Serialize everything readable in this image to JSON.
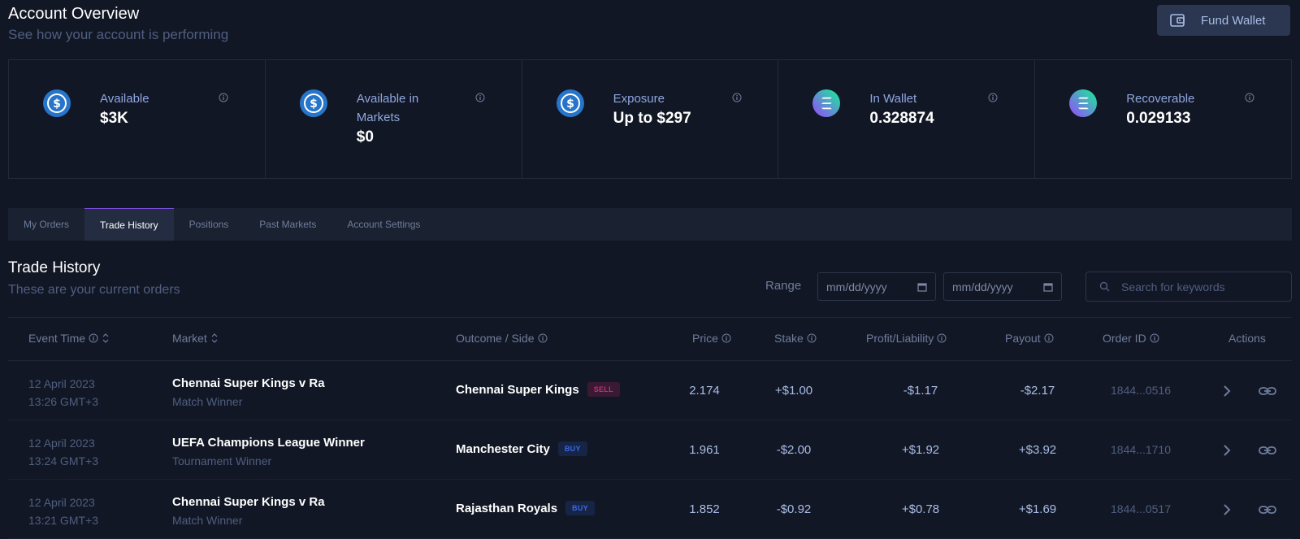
{
  "header": {
    "title": "Account Overview",
    "subtitle": "See how your account is performing",
    "fund_button": "Fund Wallet"
  },
  "cards": [
    {
      "label": "Available",
      "value": "$3K",
      "icon": "usdc-coin-icon"
    },
    {
      "label": "Available in Markets",
      "value": "$0",
      "icon": "usdc-coin-icon"
    },
    {
      "label": "Exposure",
      "value": "Up to $297",
      "icon": "usdc-coin-icon"
    },
    {
      "label": "In Wallet",
      "value": "0.328874",
      "icon": "solana-coin-icon"
    },
    {
      "label": "Recoverable",
      "value": "0.029133",
      "icon": "solana-coin-icon"
    }
  ],
  "tabs": [
    {
      "label": "My Orders"
    },
    {
      "label": "Trade History",
      "active": true
    },
    {
      "label": "Positions"
    },
    {
      "label": "Past Markets"
    },
    {
      "label": "Account Settings"
    }
  ],
  "section": {
    "title": "Trade History",
    "subtitle": "These are your current orders",
    "range_label": "Range",
    "date_from_placeholder": "mm/dd/yyyy",
    "date_to_placeholder": "mm/dd/yyyy",
    "search_placeholder": "Search for keywords"
  },
  "table": {
    "columns": [
      "Event Time",
      "Market",
      "Outcome / Side",
      "Price",
      "Stake",
      "Profit/Liability",
      "Payout",
      "Order ID",
      "Actions"
    ],
    "rows": [
      {
        "date": "12 April 2023",
        "time": "13:26 GMT+3",
        "market": "Chennai Super Kings v Ra",
        "market_type": "Match Winner",
        "outcome": "Chennai Super Kings",
        "side": "SELL",
        "price": "2.174",
        "stake": "+$1.00",
        "profit": "-$1.17",
        "payout": "-$2.17",
        "order_id": "1844...0516"
      },
      {
        "date": "12 April 2023",
        "time": "13:24 GMT+3",
        "market": "UEFA Champions League Winner",
        "market_type": "Tournament Winner",
        "outcome": "Manchester City",
        "side": "BUY",
        "price": "1.961",
        "stake": "-$2.00",
        "profit": "+$1.92",
        "payout": "+$3.92",
        "order_id": "1844...1710"
      },
      {
        "date": "12 April 2023",
        "time": "13:21 GMT+3",
        "market": "Chennai Super Kings v Ra",
        "market_type": "Match Winner",
        "outcome": "Rajasthan Royals",
        "side": "BUY",
        "price": "1.852",
        "stake": "-$0.92",
        "profit": "+$0.78",
        "payout": "+$1.69",
        "order_id": "1844...0517"
      }
    ]
  },
  "colors": {
    "background": "#121725",
    "accent": "#7b4fe0",
    "sell": "#c0307e",
    "buy": "#3d6ae0"
  }
}
